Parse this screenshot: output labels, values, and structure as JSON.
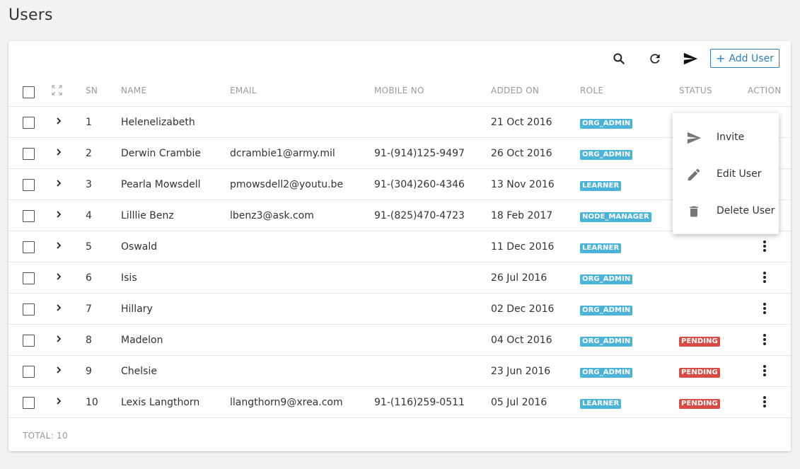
{
  "page": {
    "title": "Users"
  },
  "toolbar": {
    "search_icon": "search-icon",
    "refresh_icon": "refresh-icon",
    "send_icon": "send-icon",
    "add_user_plus": "+",
    "add_user_label": "Add User"
  },
  "table": {
    "headers": {
      "sn": "SN",
      "name": "NAME",
      "email": "EMAIL",
      "mobile": "MOBILE NO",
      "added_on": "ADDED ON",
      "role": "ROLE",
      "status": "STATUS",
      "action": "ACTION"
    },
    "rows": [
      {
        "sn": "1",
        "name": "Helenelizabeth",
        "email": "",
        "mobile": "",
        "added_on": "21 Oct 2016",
        "role": "ORG_ADMIN",
        "status": ""
      },
      {
        "sn": "2",
        "name": "Derwin Crambie",
        "email": "dcrambie1@army.mil",
        "mobile": "91-(914)125-9497",
        "added_on": "26 Oct 2016",
        "role": "ORG_ADMIN",
        "status": ""
      },
      {
        "sn": "3",
        "name": "Pearla Mowsdell",
        "email": "pmowsdell2@youtu.be",
        "mobile": "91-(304)260-4346",
        "added_on": "13 Nov 2016",
        "role": "LEARNER",
        "status": ""
      },
      {
        "sn": "4",
        "name": "Lilllie Benz",
        "email": "lbenz3@ask.com",
        "mobile": "91-(825)470-4723",
        "added_on": "18 Feb 2017",
        "role": "NODE_MANAGER",
        "status": ""
      },
      {
        "sn": "5",
        "name": "Oswald",
        "email": "",
        "mobile": "",
        "added_on": "11 Dec 2016",
        "role": "LEARNER",
        "status": ""
      },
      {
        "sn": "6",
        "name": "Isis",
        "email": "",
        "mobile": "",
        "added_on": "26 Jul 2016",
        "role": "ORG_ADMIN",
        "status": ""
      },
      {
        "sn": "7",
        "name": "Hillary",
        "email": "",
        "mobile": "",
        "added_on": "02 Dec 2016",
        "role": "ORG_ADMIN",
        "status": ""
      },
      {
        "sn": "8",
        "name": "Madelon",
        "email": "",
        "mobile": "",
        "added_on": "04 Oct 2016",
        "role": "ORG_ADMIN",
        "status": "PENDING"
      },
      {
        "sn": "9",
        "name": "Chelsie",
        "email": "",
        "mobile": "",
        "added_on": "23 Jun 2016",
        "role": "ORG_ADMIN",
        "status": "PENDING"
      },
      {
        "sn": "10",
        "name": "Lexis Langthorn",
        "email": "llangthorn9@xrea.com",
        "mobile": "91-(116)259-0511",
        "added_on": "05 Jul 2016",
        "role": "LEARNER",
        "status": "PENDING"
      }
    ],
    "footer": "TOTAL: 10"
  },
  "action_menu": {
    "items": [
      {
        "label": "Invite",
        "icon": "send-icon"
      },
      {
        "label": "Edit User",
        "icon": "pencil-icon"
      },
      {
        "label": "Delete User",
        "icon": "trash-icon"
      }
    ]
  },
  "colors": {
    "accent": "#2c7fc1",
    "role_badge": "#4ab3d7",
    "pending_badge": "#d94c45"
  }
}
